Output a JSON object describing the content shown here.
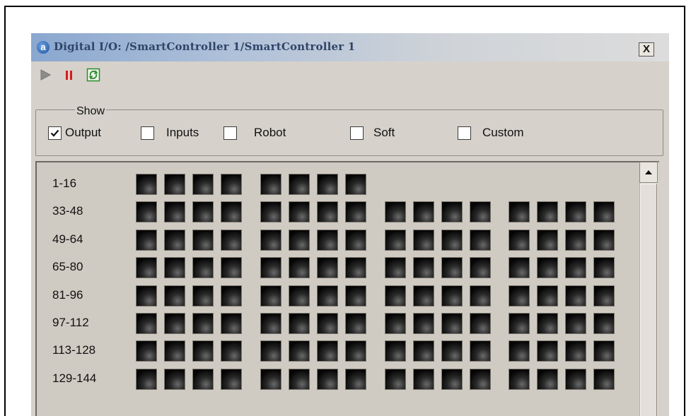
{
  "window": {
    "title": "Digital I/O: /SmartController 1/SmartController 1",
    "close_label": "X"
  },
  "toolbar": {
    "buttons": [
      {
        "name": "play",
        "icon": "play-icon",
        "enabled": false
      },
      {
        "name": "pause",
        "icon": "pause-icon"
      },
      {
        "name": "refresh",
        "icon": "refresh-icon"
      }
    ]
  },
  "show": {
    "legend": "Show",
    "options": [
      {
        "label": "Output",
        "checked": true
      },
      {
        "label": "Inputs",
        "checked": false
      },
      {
        "label": "Robot",
        "checked": false
      },
      {
        "label": "Soft",
        "checked": false
      },
      {
        "label": "Custom",
        "checked": false
      }
    ]
  },
  "io": {
    "rows": [
      {
        "label": "1-16",
        "signals": 8
      },
      {
        "label": "33-48",
        "signals": 16
      },
      {
        "label": "49-64",
        "signals": 16
      },
      {
        "label": "65-80",
        "signals": 16
      },
      {
        "label": "81-96",
        "signals": 16
      },
      {
        "label": "97-112",
        "signals": 16
      },
      {
        "label": "113-128",
        "signals": 16
      },
      {
        "label": "129-144",
        "signals": 16
      }
    ]
  },
  "colors": {
    "pause": "#d81b1b",
    "refresh": "#2a8a2a",
    "play_disabled": "#8c8c8c"
  }
}
